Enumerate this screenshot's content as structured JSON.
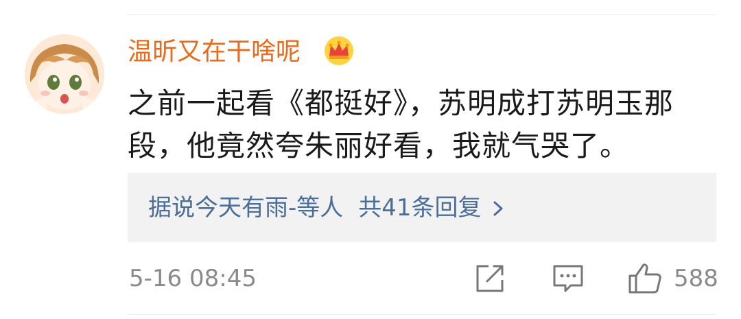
{
  "comment": {
    "username": "温昕又在干啥呢",
    "text": "之前一起看《都挺好》，苏明成打苏明玉那段，他竟然夸朱丽好看，我就气哭了。",
    "timestamp": "5-16 08:45"
  },
  "reply_preview": {
    "author": "据说今天有雨-等人",
    "count_text": "共41条回复"
  },
  "actions": {
    "like_count": "588"
  },
  "icons": {
    "vip": "crown-icon",
    "share": "share-icon",
    "comment": "comment-icon",
    "like": "thumbs-up-icon",
    "reply_arrow": "chevron-right-icon"
  },
  "colors": {
    "username": "#e86a1a",
    "reply_link": "#4a6e98",
    "meta": "#8a8a8a",
    "reply_bg": "#f2f2f2"
  }
}
